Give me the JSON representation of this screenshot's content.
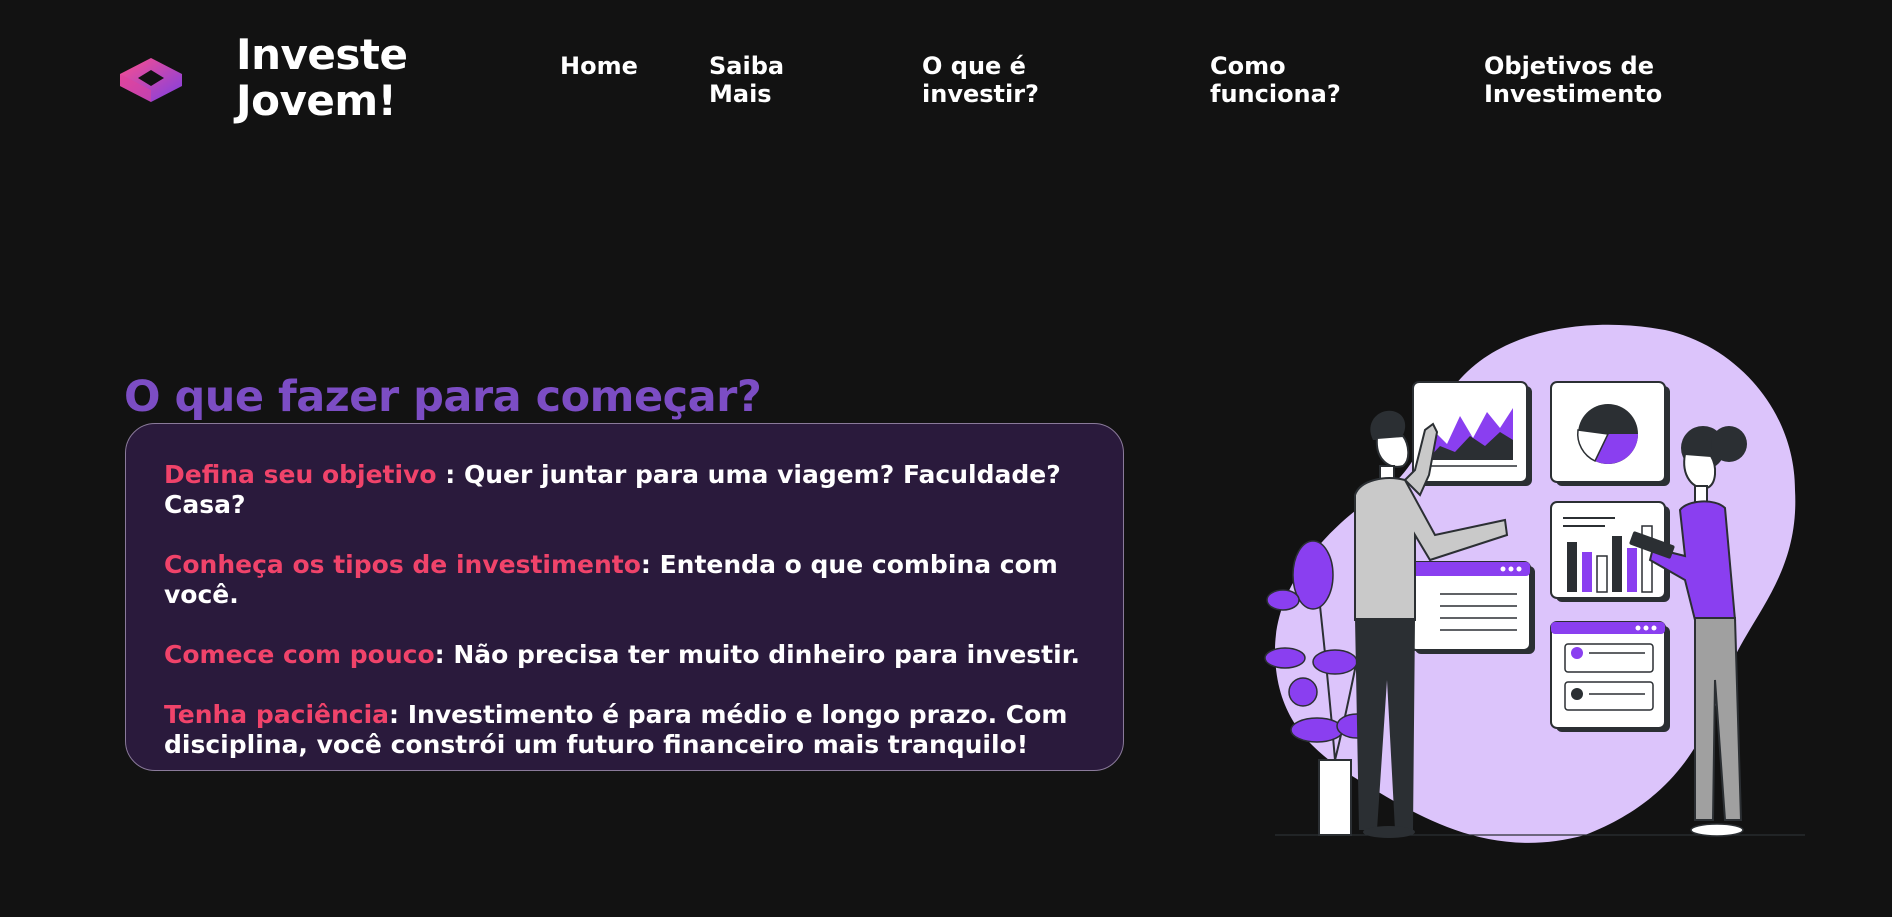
{
  "brand": {
    "line1": "Investe",
    "line2": "Jovem!"
  },
  "nav": {
    "items": [
      {
        "label": "Home"
      },
      {
        "label": "Saiba\nMais"
      },
      {
        "label": "O que é\ninvestir?"
      },
      {
        "label": "Como\nfunciona?"
      },
      {
        "label": "Objetivos de\nInvestimento"
      }
    ]
  },
  "main": {
    "title": "O que fazer para começar?",
    "tips": [
      {
        "highlight": "Defina seu objetivo",
        "text": " : Quer juntar para uma viagem? Faculdade? Casa?"
      },
      {
        "highlight": "Conheça os tipos de investimento",
        "text": ": Entenda o que combina com você."
      },
      {
        "highlight": "Comece com pouco",
        "text": ": Não precisa ter muito dinheiro para investir."
      },
      {
        "highlight": "Tenha paciência",
        "text": ": Investimento é para médio e longo prazo. Com disciplina, você constrói um futuro financeiro mais tranquilo!"
      }
    ]
  },
  "colors": {
    "background": "#121212",
    "title_purple": "#7c4dc4",
    "highlight_pink": "#f0436a",
    "card_bg": "#2a1a3c",
    "illustration_blob": "#dcc4fb",
    "illustration_accent": "#8a3ff0"
  },
  "icons": {
    "logo": "isometric-cube-logo-icon"
  }
}
